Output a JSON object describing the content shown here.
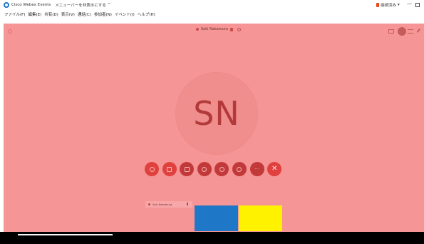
{
  "titlebar": {
    "app_title": "Cisco Webex Events",
    "menu_hint": "メニューバーを非表示にする",
    "menu_hint_chevron": "^",
    "connection_status": "接続済み",
    "connection_caret": "▾",
    "minimize": "—"
  },
  "menubar": {
    "items": [
      "ファイル(F)",
      "編集(E)",
      "共有(D)",
      "表示(V)",
      "通話(C)",
      "参加者(N)",
      "イベント(I)",
      "ヘルプ(H)"
    ]
  },
  "meeting": {
    "speaker_name": "Saki Nakamura",
    "avatar_initials": "SN",
    "self_view_name": "Saki Nakamura"
  },
  "controls": {
    "leave_glyph": "✕",
    "more_glyph": "···"
  },
  "colors": {
    "stage_bg": "#f59595",
    "control_red": "#e0403e",
    "control_dark": "#c2393a",
    "tile_blue": "#1f77c8",
    "tile_yellow": "#fff200"
  }
}
